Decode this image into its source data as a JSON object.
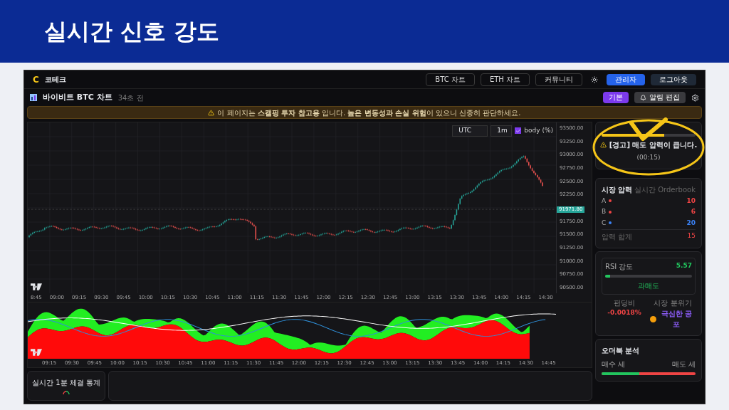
{
  "slide": {
    "title": "실시간 신호 강도"
  },
  "app": {
    "logo": "C",
    "brand": "코테크",
    "nav": [
      {
        "label": "BTC 차트",
        "kind": "outline"
      },
      {
        "label": "ETH 차트",
        "kind": "outline"
      },
      {
        "label": "커뮤니티",
        "kind": "outline"
      },
      {
        "kind": "theme"
      },
      {
        "label": "관리자",
        "kind": "primary"
      },
      {
        "label": "로그아웃",
        "kind": "dark"
      }
    ],
    "page": {
      "title": "바이비트 BTC 차트",
      "updated": "34초 전",
      "buttons": [
        {
          "label": "기본",
          "kind": "accent"
        },
        {
          "label": "알림 편집",
          "kind": "secondary"
        }
      ]
    },
    "notice": "이 페이지는 **스캘핑 투자 참고용** 입니다. **높은 변동성과 손실 위험**이 있으니 신중히 판단하세요.",
    "chart": {
      "timezone": "UTC",
      "interval": "1m",
      "toggle": {
        "label": "body (%)",
        "checked": true
      },
      "price_axis": [
        "93500.00",
        "93250.00",
        "93000.00",
        "92750.00",
        "92500.00",
        "92250.00",
        "91750.00",
        "91500.00",
        "91250.00",
        "91000.00",
        "90750.00",
        "90500.00"
      ],
      "last_price": "91971.80",
      "time_axis": [
        "8:45",
        "09:00",
        "09:15",
        "09:30",
        "09:45",
        "10:00",
        "10:15",
        "10:30",
        "10:45",
        "11:00",
        "11:15",
        "11:30",
        "11:45",
        "12:00",
        "12:15",
        "12:30",
        "12:45",
        "13:00",
        "13:15",
        "13:30",
        "13:45",
        "14:00",
        "14:15",
        "14:30"
      ],
      "osc_time_axis": [
        "09:15",
        "09:30",
        "09:45",
        "10:00",
        "10:15",
        "10:30",
        "10:45",
        "11:00",
        "11:15",
        "11:30",
        "11:45",
        "12:00",
        "12:15",
        "12:30",
        "12:45",
        "13:00",
        "13:15",
        "13:30",
        "13:45",
        "14:00",
        "14:15",
        "14:30",
        "14:45"
      ]
    },
    "signal": {
      "level": 0.67,
      "warning": "[경고] 매도 압력이 큽니다.",
      "time": "(00:15)"
    },
    "pressure": {
      "title": "시장 압력",
      "subtitle": "실시간 Orderbook",
      "rows": [
        {
          "label": "A",
          "value": "10",
          "color": "#ef4444"
        },
        {
          "label": "B",
          "value": "6",
          "color": "#ef4444"
        },
        {
          "label": "C",
          "value": "20",
          "color": "#3b82f6"
        }
      ],
      "total_label": "압력 합계",
      "total": "15"
    },
    "rsi": {
      "label": "RSI 강도",
      "value": "5.57",
      "level": 0.06,
      "state": "과매도",
      "funding_label": "펀딩비",
      "funding": "-0.0018%",
      "mood_label": "시장 분위기",
      "mood": "극심한 공포"
    },
    "orderbook": {
      "title": "오더북 분석",
      "buy_label": "매수 세",
      "sell_label": "매도 세",
      "level": 0.4
    },
    "stats_card": {
      "title": "실시간 1분 체결 통계"
    }
  }
}
